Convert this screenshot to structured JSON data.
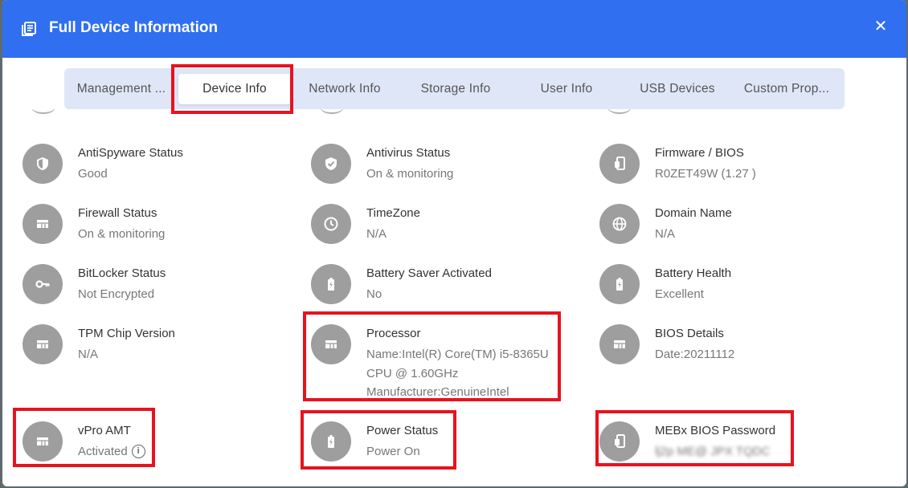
{
  "dialog": {
    "title": "Full Device Information",
    "close_glyph": "✕"
  },
  "tabs": [
    {
      "label": "Management ..."
    },
    {
      "label": "Device Info",
      "active": true
    },
    {
      "label": "Network Info"
    },
    {
      "label": "Storage Info"
    },
    {
      "label": "User Info"
    },
    {
      "label": "USB Devices"
    },
    {
      "label": "Custom Prop..."
    }
  ],
  "items": {
    "antispyware": {
      "label": "AntiSpyware Status",
      "value": "Good",
      "icon": "shield-icon"
    },
    "antivirus": {
      "label": "Antivirus Status",
      "value": "On & monitoring",
      "icon": "shield-check-icon"
    },
    "firmware": {
      "label": "Firmware / BIOS",
      "value": "R0ZET49W (1.27 )",
      "icon": "device-icon"
    },
    "firewall": {
      "label": "Firewall Status",
      "value": "On & monitoring",
      "icon": "table-icon"
    },
    "timezone": {
      "label": "TimeZone",
      "value": "N/A",
      "icon": "clock-icon"
    },
    "domain": {
      "label": "Domain Name",
      "value": "N/A",
      "icon": "globe-icon"
    },
    "bitlocker": {
      "label": "BitLocker Status",
      "value": "Not Encrypted",
      "icon": "key-icon"
    },
    "battery_saver": {
      "label": "Battery Saver Activated",
      "value": "No",
      "icon": "battery-icon"
    },
    "battery_health": {
      "label": "Battery Health",
      "value": "Excellent",
      "icon": "battery-icon"
    },
    "tpm": {
      "label": "TPM Chip Version",
      "value": "N/A",
      "icon": "table-icon"
    },
    "processor": {
      "label": "Processor",
      "value_lines": [
        "Name:Intel(R) Core(TM) i5-8365U",
        "CPU @ 1.60GHz",
        "Manufacturer:GenuineIntel"
      ],
      "icon": "table-icon"
    },
    "bios_details": {
      "label": "BIOS Details",
      "value": "Date:20211112",
      "icon": "table-icon"
    },
    "vpro": {
      "label": "vPro AMT",
      "value": "Activated",
      "icon": "table-icon",
      "info_glyph": "i"
    },
    "power": {
      "label": "Power Status",
      "value": "Power On",
      "icon": "battery-icon"
    },
    "mebx": {
      "label": "MEBx BIOS Password",
      "value": "lj2p ME@ JPX TQDC",
      "icon": "device-icon"
    }
  },
  "colors": {
    "header": "#2f6ff0",
    "highlight": "#e8121e",
    "icon_circle": "#9e9e9e",
    "tab_bar": "#dfe6f7"
  }
}
